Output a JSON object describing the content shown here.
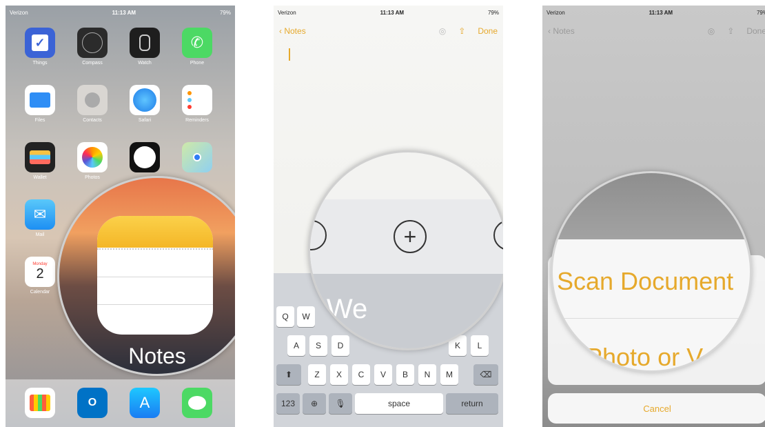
{
  "status": {
    "carrier": "Verizon",
    "time": "11:13 AM",
    "battery": "79%"
  },
  "panel1": {
    "apps_row1": [
      "Things",
      "Compass",
      "Watch",
      "Phone"
    ],
    "apps_row2": [
      "Files",
      "Contacts",
      "Safari",
      "Reminders"
    ],
    "apps_row3": [
      "Wallet",
      "Photos",
      "",
      "Maps"
    ],
    "apps_row4": [
      "Mail"
    ],
    "calendar": {
      "day": "Monday",
      "date": "2",
      "label": "Calendar"
    },
    "magnified_label": "Notes"
  },
  "panel2": {
    "back_label": "Notes",
    "done_label": "Done",
    "magnified_word": "We",
    "keys_row1": [
      "Q",
      "W"
    ],
    "keys_row2": [
      "A",
      "S",
      "D",
      "K",
      "L"
    ],
    "keys_row3": [
      "Z",
      "X",
      "C",
      "V",
      "B",
      "N",
      "M"
    ],
    "key_123": "123",
    "key_space": "space",
    "key_return": "return"
  },
  "panel3": {
    "back_label": "Notes",
    "done_label": "Done",
    "scan_label": "Scan Document",
    "photo_label": "Photo or V",
    "cancel_label": "Cancel"
  },
  "colors": {
    "accent": "#e6a92c",
    "keyboard": "#d1d4d9"
  }
}
